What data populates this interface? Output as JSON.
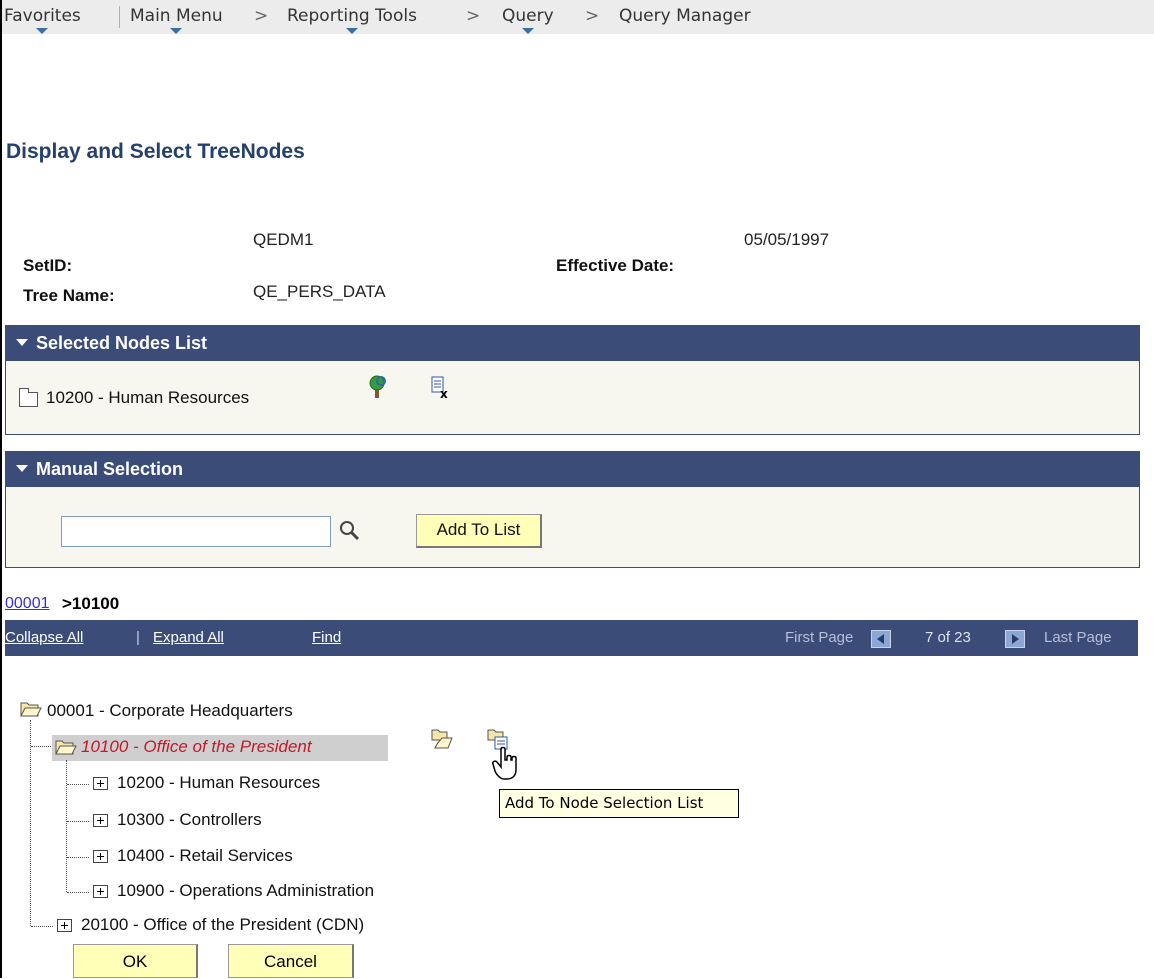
{
  "breadcrumb": {
    "items": [
      "Favorites",
      "Main Menu",
      "Reporting Tools",
      "Query",
      "Query Manager"
    ],
    "separator": ">"
  },
  "page": {
    "title": "Display and Select TreeNodes"
  },
  "fields": {
    "setid_label": "SetID:",
    "setid_value": "QEDM1",
    "effdate_label": "Effective Date:",
    "effdate_value": "05/05/1997",
    "treename_label": "Tree Name:",
    "treename_value": "QE_PERS_DATA"
  },
  "selected_nodes": {
    "header": "Selected Nodes List",
    "items": [
      {
        "label": "10200 - Human Resources"
      }
    ]
  },
  "manual_selection": {
    "header": "Manual Selection",
    "input_value": "",
    "add_button": "Add To List"
  },
  "path": {
    "link": "00001",
    "current": ">10100"
  },
  "tree_nav": {
    "collapse_all": "Collapse All",
    "expand_all": "Expand All",
    "pipe": "|",
    "find": "Find",
    "first_page": "First Page",
    "page_status": "7 of 23",
    "last_page": "Last Page"
  },
  "tree": {
    "root": "00001 - Corporate Headquarters",
    "current": "10100 - Office of the President",
    "children": [
      "10200 - Human Resources",
      "10300 - Controllers",
      "10400 - Retail Services",
      "10900 - Operations Administration"
    ],
    "sibling": "20100 - Office of the President (CDN)"
  },
  "tooltip": "Add To Node Selection List",
  "buttons": {
    "ok": "OK",
    "cancel": "Cancel"
  },
  "colors": {
    "header_bg": "#3b4c78",
    "title": "#25406b",
    "current_node": "#c4182b",
    "button_bg": "#ffffb7",
    "link": "#3333cc"
  }
}
